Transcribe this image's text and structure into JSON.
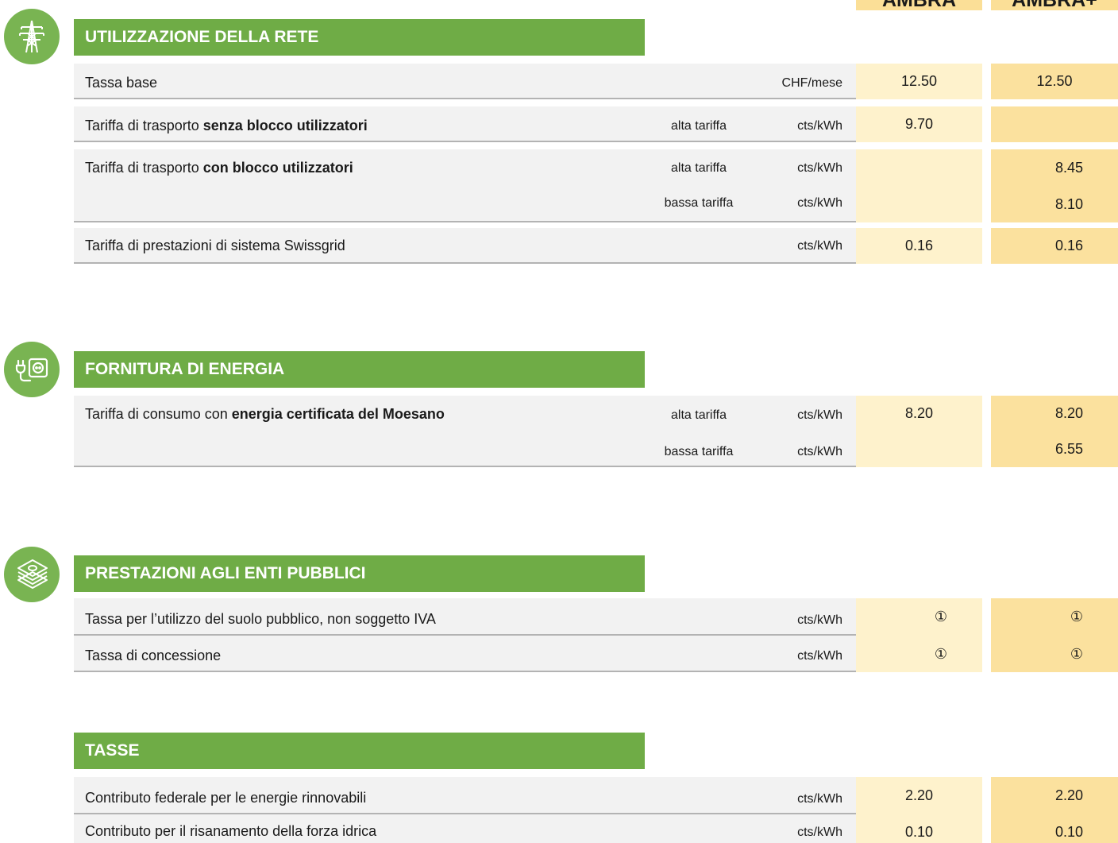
{
  "columns": [
    "AMBRA",
    "AMBRA+"
  ],
  "sections": [
    {
      "title": "UTILIZZAZIONE DELLA RETE",
      "icon": "power-pylon-icon",
      "rows": [
        {
          "label": "Tassa base",
          "tariff": "",
          "unit": "CHF/mese",
          "ambra": "12.50",
          "ambra_plus": "12.50"
        },
        {
          "label_pre": "Tariffa di trasporto ",
          "label_bold": "senza blocco utilizzatori",
          "tariff": "alta tariffa",
          "unit": "cts/kWh",
          "ambra": "9.70",
          "ambra_plus": ""
        },
        {
          "label_pre": "Tariffa di trasporto ",
          "label_bold": "con blocco utilizzatori",
          "tariff": "alta tariffa",
          "unit": "cts/kWh",
          "ambra": "",
          "ambra_plus": "8.45",
          "tariff2": "bassa tariffa",
          "unit2": "cts/kWh",
          "ambra2": "",
          "ambra_plus2": "8.10"
        },
        {
          "label": "Tariffa di prestazioni di sistema Swissgrid",
          "tariff": "",
          "unit": "cts/kWh",
          "ambra": "0.16",
          "ambra_plus": "0.16"
        }
      ]
    },
    {
      "title": "FORNITURA DI ENERGIA",
      "icon": "plug-socket-icon",
      "rows": [
        {
          "label_pre": "Tariffa di consumo con ",
          "label_bold": "energia certificata del Moesano",
          "tariff": "alta tariffa",
          "unit": "cts/kWh",
          "ambra": "8.20",
          "ambra_plus": "8.20",
          "tariff2": "bassa tariffa",
          "unit2": "cts/kWh",
          "ambra2": "",
          "ambra_plus2": "6.55"
        }
      ]
    },
    {
      "title": "PRESTAZIONI AGLI ENTI PUBBLICI",
      "icon": "money-stack-icon",
      "rows": [
        {
          "label": "Tassa per l’utilizzo del suolo pubblico, non soggetto IVA",
          "tariff": "",
          "unit": "cts/kWh",
          "ambra": "①",
          "ambra_plus": "①"
        },
        {
          "label": "Tassa di concessione",
          "tariff": "",
          "unit": "cts/kWh",
          "ambra": "①",
          "ambra_plus": "①"
        }
      ]
    },
    {
      "title": "TASSE",
      "rows": [
        {
          "label": "Contributo federale per le energie rinnovabili",
          "tariff": "",
          "unit": "cts/kWh",
          "ambra": "2.20",
          "ambra_plus": "2.20"
        },
        {
          "label": "Contributo per il risanamento della forza idrica",
          "tariff": "",
          "unit": "cts/kWh",
          "ambra": "0.10",
          "ambra_plus": "0.10"
        }
      ]
    }
  ],
  "colors": {
    "section_green": "#6fac46",
    "icon_green": "#79b452",
    "ambra_cell": "#fef2cc",
    "ambra_plus_cell": "#fbe19e",
    "row_bg": "#f2f2f2"
  }
}
